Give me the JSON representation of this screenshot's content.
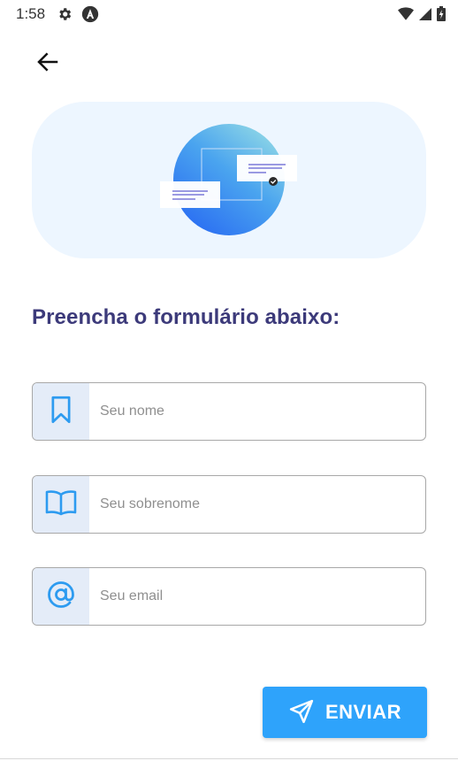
{
  "status_bar": {
    "time": "1:58",
    "left_icons": [
      "gear-icon",
      "app-icon"
    ],
    "right_icons": [
      "wifi-icon",
      "signal-icon",
      "battery-icon"
    ]
  },
  "nav": {
    "back_icon": "arrow-left-icon"
  },
  "form": {
    "title": "Preencha o formulário abaixo:",
    "fields": [
      {
        "icon": "bookmark-icon",
        "placeholder": "Seu nome",
        "value": ""
      },
      {
        "icon": "book-icon",
        "placeholder": "Seu sobrenome",
        "value": ""
      },
      {
        "icon": "at-sign-icon",
        "placeholder": "Seu email",
        "value": ""
      }
    ],
    "submit": {
      "label": "ENVIAR",
      "icon": "send-icon"
    }
  },
  "colors": {
    "accent": "#2ea3fb",
    "title": "#3c3a7a",
    "hero_background": "#edf6ff",
    "field_icon_background": "#e4ecf8",
    "icon_blue": "#2d9bf0"
  }
}
